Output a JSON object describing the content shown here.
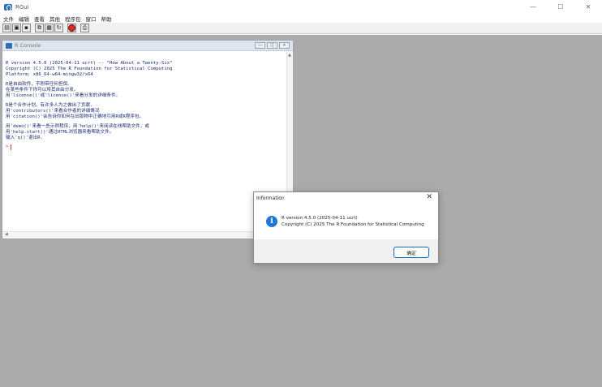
{
  "window": {
    "title": "RGui",
    "minimize_glyph": "—",
    "maximize_glyph": "☐",
    "close_glyph": "✕"
  },
  "menu": [
    "文件",
    "编辑",
    "查看",
    "其他",
    "程序包",
    "窗口",
    "帮助"
  ],
  "toolbar": {
    "buttons": [
      "open-script-icon",
      "load-workspace-icon",
      "save-workspace-icon",
      "copy-icon",
      "paste-icon",
      "copy-paste-icon",
      "stop-icon",
      "print-icon"
    ]
  },
  "console": {
    "title": "R Console",
    "lines": [
      "R version 4.5.0 (2025-04-11 ucrt) -- \"How About a Twenty-Six\"",
      "Copyright (C) 2025 The R Foundation for Statistical Computing",
      "Platform: x86_64-w64-mingw32/x64",
      "",
      "R是自由软件，不附带任何担保。",
      "在某些条件下你可以将其自由分发。",
      "用'license()'或'licence()'来看分发的详细条件。",
      "",
      "R是个合作计划，有许多人为之做出了贡献.",
      "用'contributors()'来看合作者的详细情况",
      "用'citation()'会告诉你如何在出版物中正确地引用R或R程序包。",
      "",
      "用'demo()'来看一些示例程序，用'help()'来阅读在线帮助文件，或",
      "用'help.start()'通过HTML浏览器来看帮助文件。",
      "输入'q()'退出R."
    ],
    "prompt": ">"
  },
  "dialog": {
    "title": "Information",
    "close_glyph": "✕",
    "icon_glyph": "i",
    "message_line1": "R version 4.5.0 (2025-04-11 ucrt)",
    "message_line2": "Copyright (C) 2025 The R Foundation for Statistical Computing",
    "ok_label": "确定"
  },
  "colors": {
    "mdi_background": "#ababab",
    "console_text": "#1c2a74",
    "prompt": "#e0303a",
    "info_icon": "#1f78d1",
    "ok_border": "#0f6cbd"
  }
}
